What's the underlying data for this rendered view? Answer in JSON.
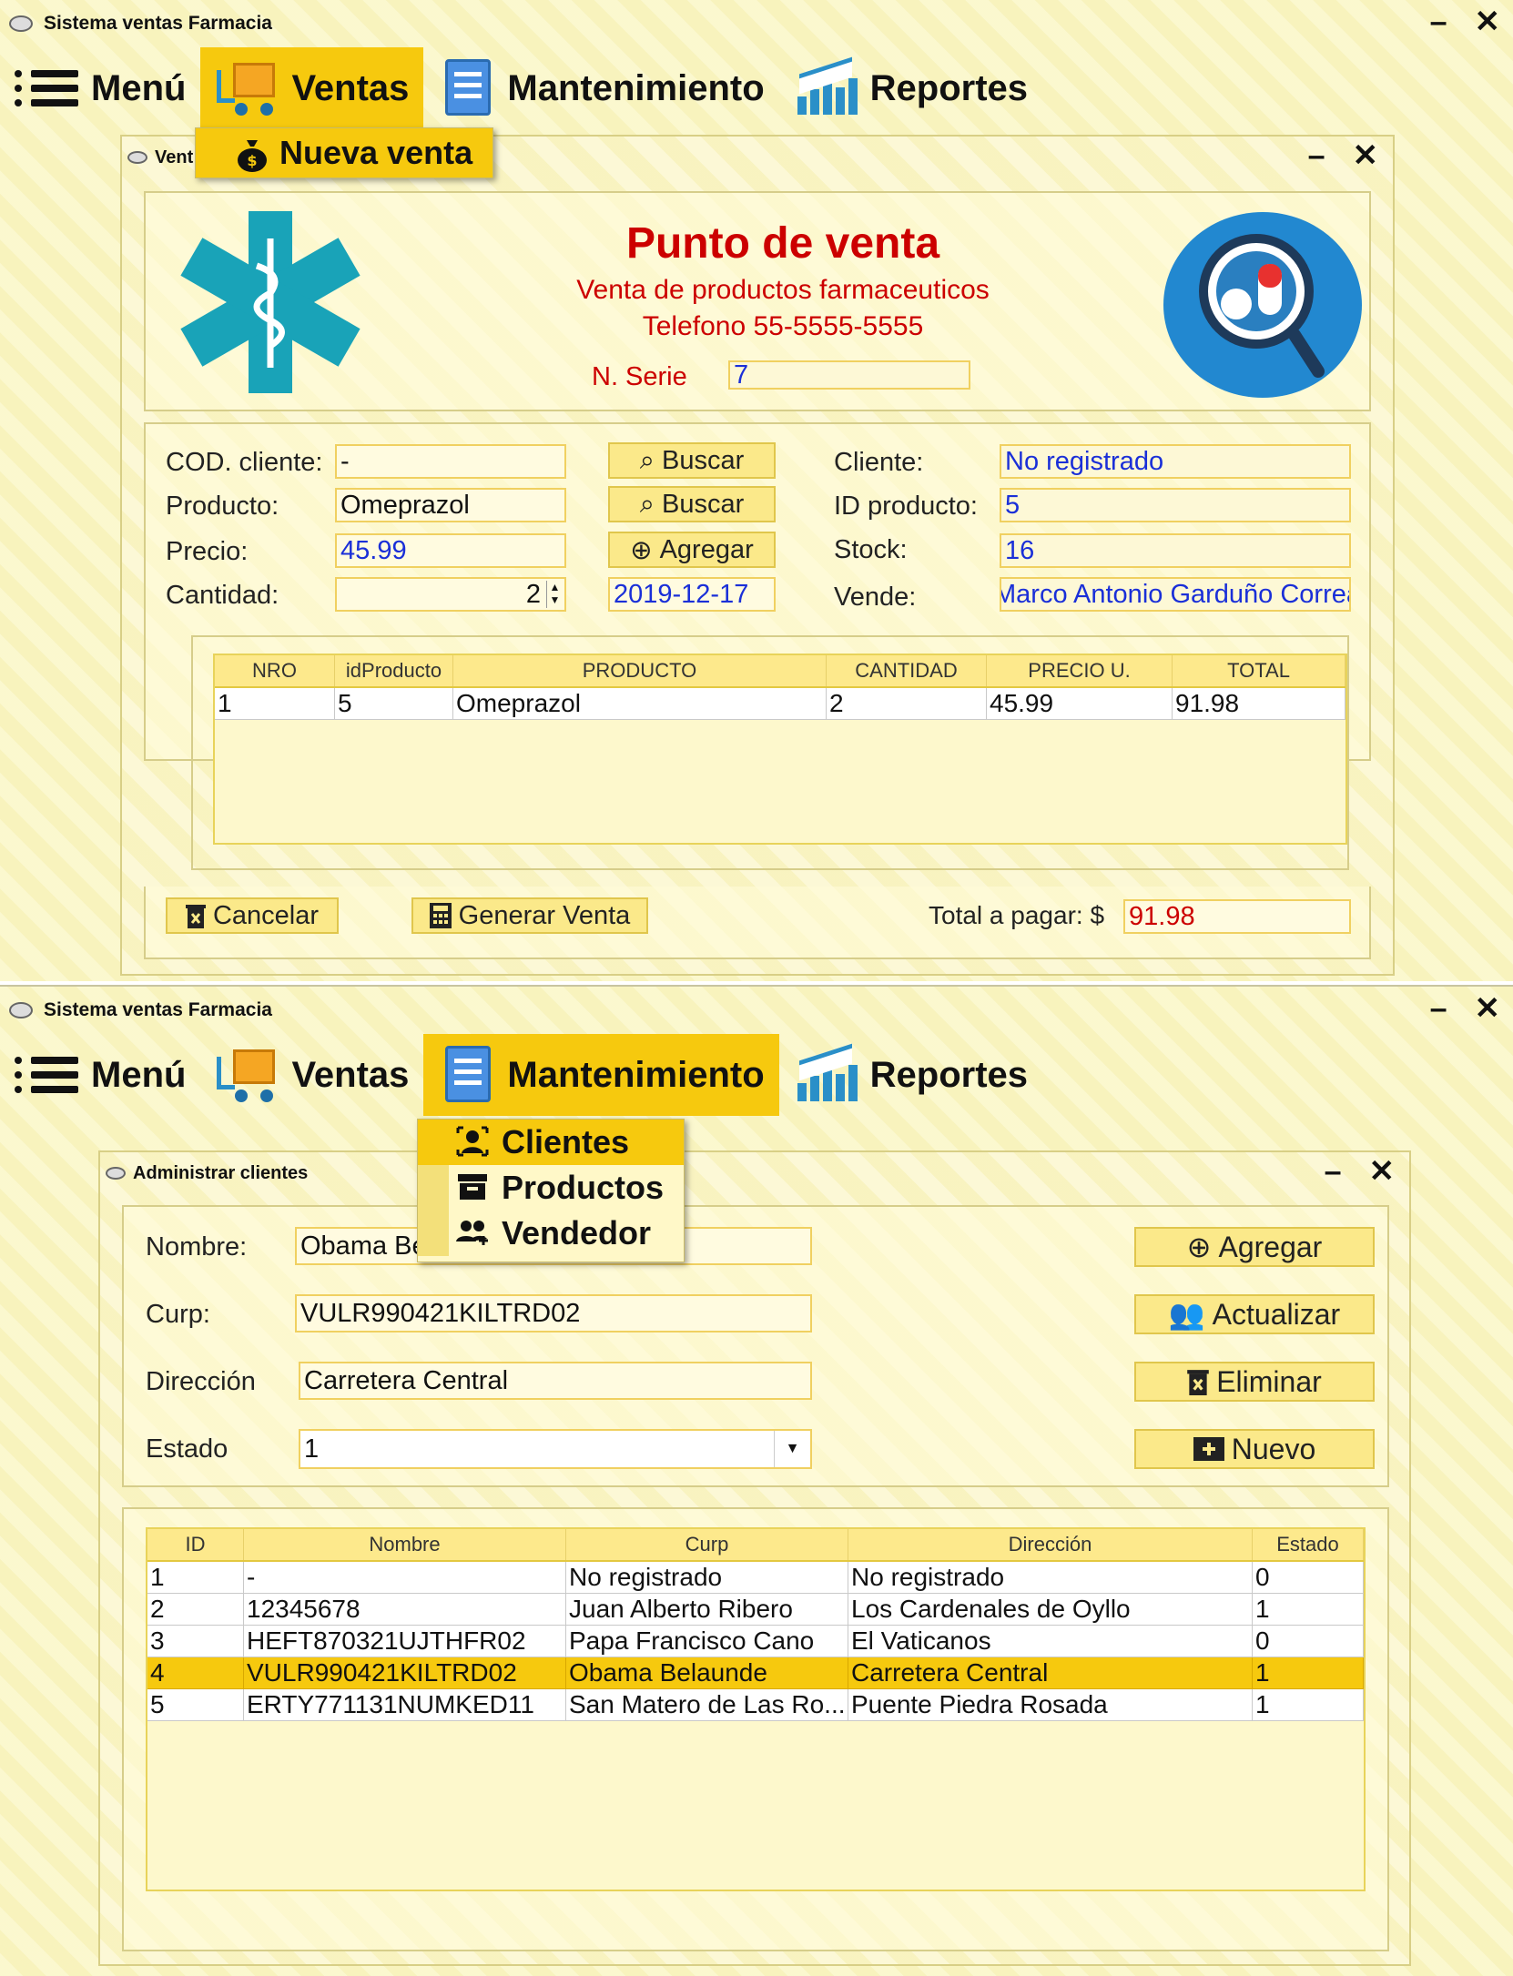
{
  "screen1": {
    "window_title": "Sistema ventas Farmacia",
    "menu": {
      "menu": "Menú",
      "ventas": "Ventas",
      "mantenimiento": "Mantenimiento",
      "reportes": "Reportes"
    },
    "dropdown": {
      "nueva_venta": "Nueva venta"
    },
    "inner": {
      "title": "Vent",
      "header": {
        "title": "Punto de venta",
        "subtitle": "Venta de productos farmaceuticos",
        "phone": "Telefono 55-5555-5555",
        "serie_label": "N. Serie",
        "serie_value": "7"
      },
      "form": {
        "cod_cliente_label": "COD. cliente:",
        "cod_cliente_value": "-",
        "producto_label": "Producto:",
        "producto_value": "Omeprazol",
        "precio_label": "Precio:",
        "precio_value": "45.99",
        "cantidad_label": "Cantidad:",
        "cantidad_value": "2",
        "buscar1": "Buscar",
        "buscar2": "Buscar",
        "agregar": "Agregar",
        "fecha": "2019-12-17",
        "cliente_label": "Cliente:",
        "cliente_value": "No registrado",
        "id_producto_label": "ID producto:",
        "id_producto_value": "5",
        "stock_label": "Stock:",
        "stock_value": "16",
        "vende_label": "Vende:",
        "vende_value": "Marco Antonio Garduño Correa"
      },
      "table": {
        "headers": [
          "NRO",
          "idProducto",
          "PRODUCTO",
          "CANTIDAD",
          "PRECIO U.",
          "TOTAL"
        ],
        "rows": [
          [
            "1",
            "5",
            "Omeprazol",
            "2",
            "45.99",
            "91.98"
          ]
        ]
      },
      "footer": {
        "cancelar": "Cancelar",
        "generar": "Generar Venta",
        "total_label": "Total a pagar: $",
        "total_value": "91.98"
      }
    }
  },
  "screen2": {
    "window_title": "Sistema ventas Farmacia",
    "menu": {
      "menu": "Menú",
      "ventas": "Ventas",
      "mantenimiento": "Mantenimiento",
      "reportes": "Reportes"
    },
    "dropdown": {
      "clientes": "Clientes",
      "productos": "Productos",
      "vendedor": "Vendedor"
    },
    "inner": {
      "title": "Administrar clientes",
      "form": {
        "nombre_label": "Nombre:",
        "nombre_value": "Obama Be",
        "curp_label": "Curp:",
        "curp_value": "VULR990421KILTRD02",
        "direccion_label": "Dirección",
        "direccion_value": "Carretera Central",
        "estado_label": "Estado",
        "estado_value": "1"
      },
      "buttons": {
        "agregar": "Agregar",
        "actualizar": "Actualizar",
        "eliminar": "Eliminar",
        "nuevo": "Nuevo"
      },
      "table": {
        "headers": [
          "ID",
          "Nombre",
          "Curp",
          "Dirección",
          "Estado"
        ],
        "rows": [
          [
            "1",
            "-",
            "No registrado",
            "No registrado",
            "0"
          ],
          [
            "2",
            "12345678",
            "Juan Alberto Ribero",
            "Los Cardenales de Oyllo",
            "1"
          ],
          [
            "3",
            "HEFT870321UJTHFR02",
            "Papa Francisco Cano",
            "El Vaticanos",
            "0"
          ],
          [
            "4",
            "VULR990421KILTRD02",
            "Obama Belaunde",
            "Carretera Central",
            "1"
          ],
          [
            "5",
            "ERTY771131NUMKED11",
            "San Matero de Las Ro...",
            "Puente Piedra Rosada",
            "1"
          ]
        ]
      }
    }
  },
  "colors": {
    "accent": "#f6c90e",
    "title_red": "#cc0000",
    "link_blue": "#1a2fd8",
    "medical_teal": "#19a3b8"
  }
}
